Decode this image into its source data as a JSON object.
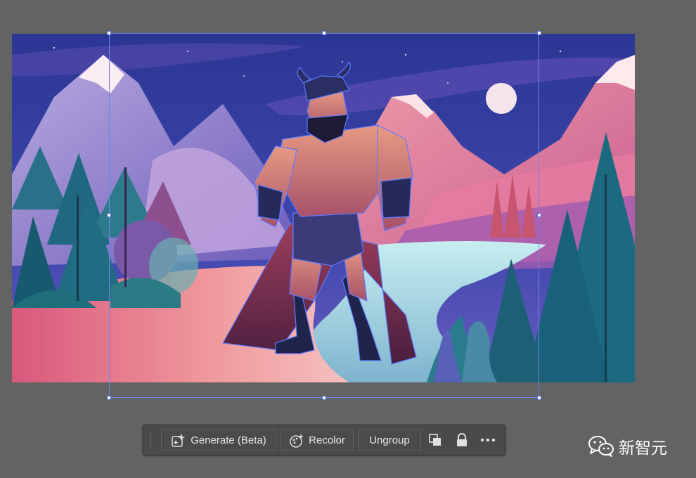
{
  "canvas": {
    "artwork": "barbarian-warrior-mountain-landscape-illustration",
    "colors": {
      "sky": "#2f3a9a",
      "moon": "#f6e4ec",
      "mountains": "#e07e9c",
      "ground": "#e56f84",
      "river": "#9fd0dc",
      "trees": "#1c6274",
      "selection": "#6f86e6"
    }
  },
  "contextual_taskbar": {
    "generate_label": "Generate (Beta)",
    "recolor_label": "Recolor",
    "ungroup_label": "Ungroup",
    "arrange_icon": "arrange-icon",
    "lock_icon": "lock-icon",
    "more_icon": "more-icon"
  },
  "watermark": {
    "text": "新智元",
    "icon": "wechat-icon"
  }
}
